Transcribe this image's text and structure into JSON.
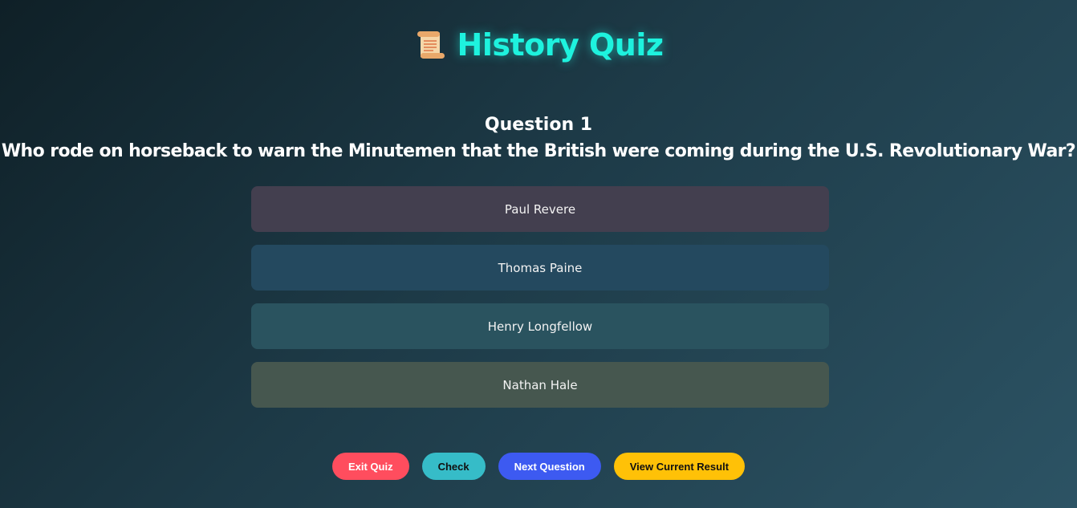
{
  "header": {
    "icon": "scroll-icon",
    "title": "History Quiz"
  },
  "question": {
    "number_label": "Question 1",
    "text": "Who rode on horseback to warn the Minutemen that the British were coming during the U.S. Revolutionary War?"
  },
  "options": [
    {
      "label": "Paul Revere"
    },
    {
      "label": "Thomas Paine"
    },
    {
      "label": "Henry Longfellow"
    },
    {
      "label": "Nathan Hale"
    }
  ],
  "buttons": {
    "exit_label": "Exit Quiz",
    "check_label": "Check",
    "next_label": "Next Question",
    "result_label": "View Current Result"
  },
  "colors": {
    "title": "#1ef2de",
    "exit": "#ff4d5e",
    "check": "#36bcc8",
    "next": "#3d5af1",
    "result": "#ffc107"
  }
}
